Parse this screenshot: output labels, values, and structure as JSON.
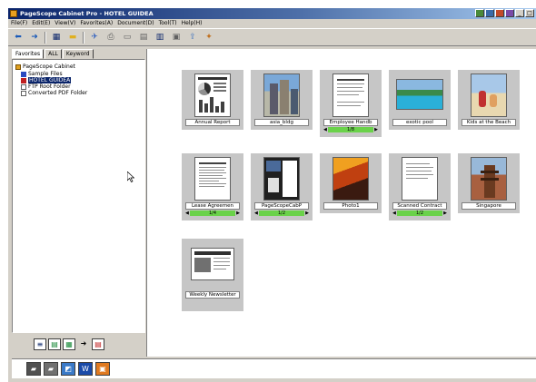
{
  "window": {
    "title": "PageScope Cabinet Pro - HOTEL GUIDEA"
  },
  "menubar": {
    "items": [
      "File(F)",
      "Edit(E)",
      "View(V)",
      "Favorites(A)",
      "Document(D)",
      "Tool(T)",
      "Help(H)"
    ]
  },
  "toolbar": {
    "icons": [
      "back-icon",
      "forward-icon",
      "properties-icon",
      "folder-icon",
      "send-icon",
      "print-icon",
      "page-icon",
      "scan-icon",
      "view-menu-icon",
      "layout-icon",
      "export-icon",
      "settings-icon"
    ]
  },
  "left_pane": {
    "tabs": [
      "Favorites",
      "ALL",
      "Keyword"
    ],
    "tree": [
      {
        "label": "PageScope Cabinet",
        "icon": "cabinet-icon",
        "depth": 0,
        "selected": false
      },
      {
        "label": "Sample Files",
        "icon": "folder-icon",
        "depth": 1,
        "selected": false
      },
      {
        "label": "HOTEL GUIDEA",
        "icon": "folder-icon",
        "depth": 1,
        "selected": true
      },
      {
        "label": "FTP Root Folder",
        "icon": "ftp-folder-icon",
        "depth": 1,
        "selected": false
      },
      {
        "label": "Converted PDF Folder",
        "icon": "pdf-folder-icon",
        "depth": 1,
        "selected": false
      }
    ]
  },
  "documents": [
    {
      "name": "Annual Report",
      "pages": null,
      "thumb": "report"
    },
    {
      "name": "asia_bldg",
      "pages": null,
      "thumb": "photo-building"
    },
    {
      "name": "Employee Handb",
      "pages": "1/8",
      "thumb": "text"
    },
    {
      "name": "exotic pool",
      "pages": null,
      "thumb": "photo-pool"
    },
    {
      "name": "Kids at the Beach",
      "pages": null,
      "thumb": "photo-beach"
    },
    {
      "name": "Lease Agreemen",
      "pages": "1/4",
      "thumb": "text"
    },
    {
      "name": "PageScopeCabP",
      "pages": "1/2",
      "thumb": "brochure"
    },
    {
      "name": "Photo1",
      "pages": null,
      "thumb": "photo-sunset"
    },
    {
      "name": "Scanned Contract",
      "pages": "1/2",
      "thumb": "text"
    },
    {
      "name": "Singapore",
      "pages": null,
      "thumb": "photo-temple"
    },
    {
      "name": "Weekly Newsletter",
      "pages": null,
      "thumb": "newsletter"
    }
  ],
  "colors": {
    "title_gradient_start": "#0a246a",
    "selection": "#0a246a",
    "pager_fill": "#6ad24a",
    "chrome": "#d4d0c8"
  }
}
